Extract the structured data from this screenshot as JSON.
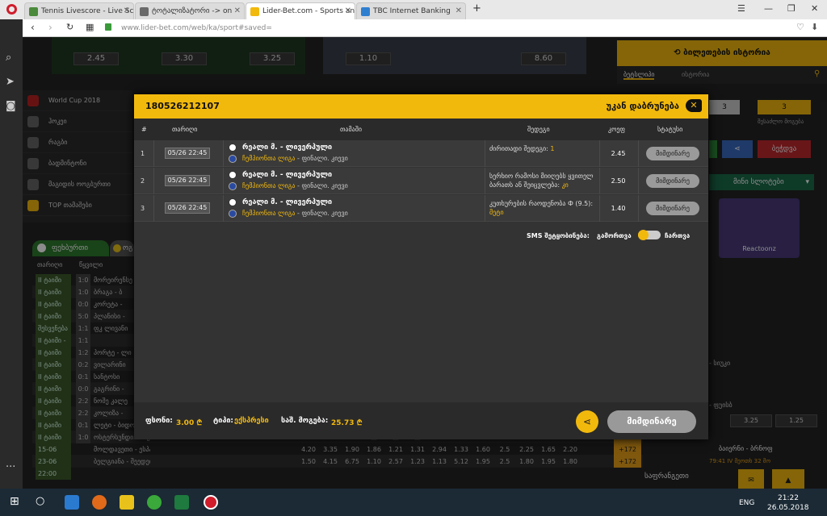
{
  "browser": {
    "tabs": [
      {
        "title": "Tennis Livescore - Live Sco"
      },
      {
        "title": "ტოტალიზატორი -> on"
      },
      {
        "title": "Lider-Bet.com - Sports an"
      },
      {
        "title": "TBC Internet Banking"
      }
    ],
    "new_tab": "+",
    "url": "www.lider-bet.com/web/ka/sport#saved="
  },
  "background": {
    "top_odds_left": [
      "2.45",
      "3.30",
      "3.25"
    ],
    "top_odds_right": [
      "1.10",
      "8.60"
    ],
    "history_button": "ბილეთების ისტორია",
    "history_tabs": [
      "ბეტსლიპი",
      "ისტორია"
    ],
    "sports": [
      "World Cup 2018",
      "ჰოკეი",
      "რაგბი",
      "ბადმინტონი",
      "მაგიდის ოოგბურთი",
      "TOP თამაშები"
    ],
    "sport_tabs": [
      "ფეხბურთი",
      "ოგ"
    ],
    "list_header": [
      "თარიღი",
      "წყვილი"
    ],
    "matches": [
      {
        "status": "II ტაიმი 69'",
        "score": "1:0",
        "team": "მორეირენსე",
        "odds": [],
        "plus": ""
      },
      {
        "status": "II ტაიმი 64'",
        "score": "1:0",
        "team": "ბრაგა - ბ",
        "odds": [],
        "plus": ""
      },
      {
        "status": "II ტაიმი 22'",
        "score": "0:0",
        "team": "კორეტა -",
        "odds": [],
        "plus": ""
      },
      {
        "status": "II ტაიმი 67'",
        "score": "5:0",
        "team": "პლანისი -",
        "odds": [],
        "plus": ""
      },
      {
        "status": "შესვენება 45",
        "score": "1:1",
        "team": "ფკ ლივანი",
        "odds": [],
        "plus": ""
      },
      {
        "status": "II ტაიმი - დამატ. დრო 112",
        "score": "1:1",
        "team": "",
        "odds": [],
        "plus": ""
      },
      {
        "status": "II ტაიმი 60'",
        "score": "1:2",
        "team": "პორტე - ლი",
        "odds": [],
        "plus": ""
      },
      {
        "status": "II ტაიმი 33'",
        "score": "0:2",
        "team": "ვილარინი",
        "odds": [],
        "plus": ""
      },
      {
        "status": "II ტაიმი 66'",
        "score": "0:1",
        "team": "სანტოსი",
        "odds": [],
        "plus": ""
      },
      {
        "status": "II ტაიმი 84'",
        "score": "0:0",
        "team": "გაგრინი -",
        "odds": [],
        "plus": ""
      },
      {
        "status": "II ტაიმი 68'",
        "score": "2:2",
        "team": "ნოშე კალე",
        "odds": [],
        "plus": ""
      },
      {
        "status": "II ტაიმი 90'",
        "score": "2:2",
        "team": "კოლიზა -",
        "odds": [],
        "plus": ""
      },
      {
        "status": "II ტაიმი 62'",
        "score": "0:1",
        "team": "ლეტი - ბიდო",
        "odds": [
          "9.75",
          "3.60",
          "1.45",
          "2.65",
          "1.03",
          "1.25",
          "5.25",
          "1.08",
          "2.55",
          "1.5",
          "1.45",
          "2.00",
          "1.75"
        ],
        "plus": "+31"
      },
      {
        "status": "II ტაიმი 66'",
        "score": "1:0",
        "team": "ოსტერსუნდი - მაკაბი",
        "odds": [
          "1.16",
          "5.75",
          "32.00",
          "",
          "",
          "",
          "1.01",
          "8.00",
          "2.30",
          "1.5",
          "1.55",
          "3.15",
          "1.30"
        ],
        "plus": "+62"
      },
      {
        "status": "15-06 22:00",
        "score": "",
        "team": "მოლდავეთი - ესპანეთი",
        "odds": [
          "4.20",
          "3.35",
          "1.90",
          "1.86",
          "1.21",
          "1.31",
          "2.94",
          "1.33",
          "1.60",
          "2.5",
          "2.25",
          "1.65",
          "2.20"
        ],
        "plus": "+172"
      },
      {
        "status": "23-06 22:00",
        "score": "",
        "team": "ბელგიანა - შეედეთი",
        "odds": [
          "1.50",
          "4.15",
          "6.75",
          "1.10",
          "2.57",
          "1.23",
          "1.13",
          "5.12",
          "1.95",
          "2.5",
          "1.80",
          "1.95",
          "1.80"
        ],
        "plus": "+172"
      }
    ],
    "right_counters": [
      "3",
      "3"
    ],
    "right_counter_label": "შესაძლო მოგება",
    "right_buttons": [
      "",
      "ბეჭდვა"
    ],
    "slots_title": "მინი სლოტები",
    "slot_name": "Reactoonz",
    "right_live": [
      {
        "title": "- სიუკი",
        "odds": []
      },
      {
        "title": "- ფუისბ",
        "odds": [
          "3.25",
          "1.25"
        ]
      },
      {
        "title": "ბაიერნი - ბრნოფ",
        "odds": []
      },
      {
        "title": "79:41 IV მეოთხ 32 მო",
        "odds": []
      },
      {
        "title": "საფრანგეთი",
        "odds": []
      }
    ]
  },
  "modal": {
    "ticket_id": "180526212107",
    "back_label": "უკან დაბრუნება",
    "columns": [
      "#",
      "თარიღი",
      "თამაში",
      "შედეგი",
      "კოეფ",
      "სტატუსი"
    ],
    "rows": [
      {
        "n": "1",
        "date": "05/26 22:45",
        "match": "რეალი მ. - ლივერპული",
        "league": "ჩემპიონთა ლიგა",
        "league_extra": " - ფინალი. კიევი",
        "pick": "ძირითადი შედეგი:",
        "pick_val": " 1",
        "coef": "2.45",
        "status": "მიმდინარე"
      },
      {
        "n": "2",
        "date": "05/26 22:45",
        "match": "რეალი მ. - ლივერპული",
        "league": "ჩემპიონთა ლიგა",
        "league_extra": " - ფინალი. კიევი",
        "pick": "სერხიო რამოსი მიიღებს ყვითელ ბარათს ან შეიცვლება:",
        "pick_val": " კი",
        "coef": "2.50",
        "status": "მიმდინარე"
      },
      {
        "n": "3",
        "date": "05/26 22:45",
        "match": "რეალი მ. - ლივერპული",
        "league": "ჩემპიონთა ლიგა",
        "league_extra": " - ფინალი. კიევი",
        "pick": "კუთხურების რაოდენობა Ф (9.5):",
        "pick_val": " მეტი",
        "coef": "1.40",
        "status": "მიმდინარე"
      }
    ],
    "sms_label": "SMS შეტყობინება:",
    "sms_off": "გამორთვა",
    "sms_on": "ჩართვა",
    "footer": {
      "stake_label": "ფსონი:",
      "stake_value": "3.00 ₾",
      "type_label": "ტიპი:",
      "type_value": "ექსპრესი",
      "win_label": "საშ. მოგება:",
      "win_value": "25.73 ₾",
      "status_button": "მიმდინარე"
    }
  },
  "taskbar": {
    "lang": "ENG",
    "time": "21:22",
    "date": "26.05.2018"
  }
}
